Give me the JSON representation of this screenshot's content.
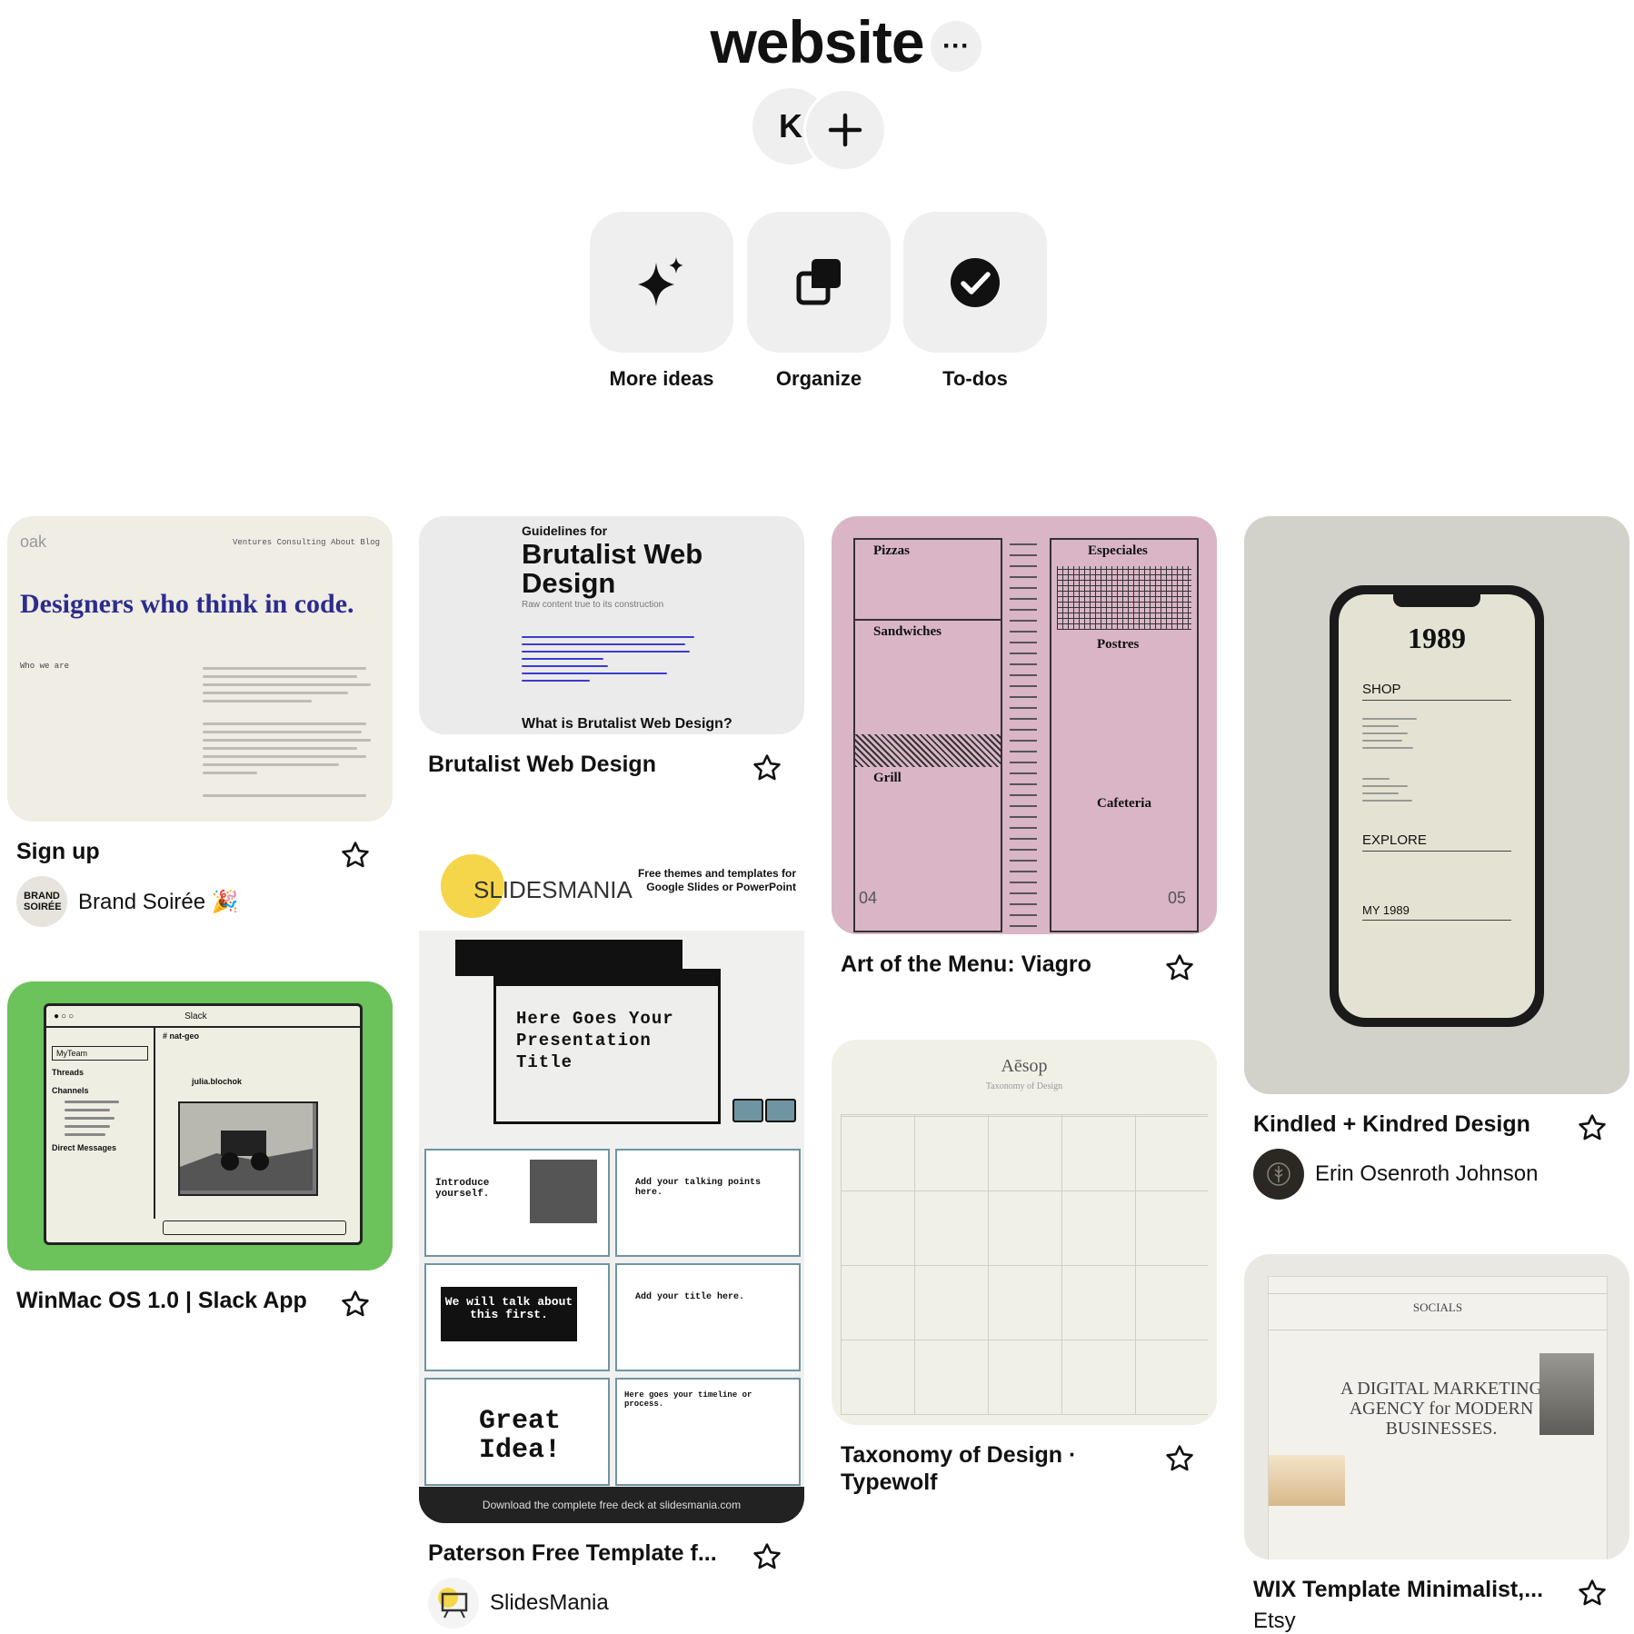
{
  "board": {
    "title": "website",
    "more_label": "···",
    "collaborator_initial": "K"
  },
  "actions": [
    {
      "label": "More ideas",
      "icon": "sparkle-icon"
    },
    {
      "label": "Organize",
      "icon": "organize-icon"
    },
    {
      "label": "To-dos",
      "icon": "check-circle-icon"
    }
  ],
  "pins": {
    "oak": {
      "title": "Sign up",
      "owner": "Brand Soirée 🎉",
      "owner_logo": "BRAND SOIRÉE",
      "img": {
        "logo": "oak",
        "nav": "Ventures   Consulting   About   Blog",
        "headline": "Designers who think in code.",
        "who": "Who we are"
      }
    },
    "slack": {
      "title": "WinMac OS 1.0 | Slack App",
      "img": {
        "app": "Slack",
        "channel": "# nat-geo",
        "team": "MyTeam",
        "threads": "Threads",
        "channels": "Channels",
        "dm": "Direct Messages",
        "user": "julia.blochok"
      }
    },
    "brutalist": {
      "title": "Brutalist Web Design",
      "img": {
        "pre": "Guidelines for",
        "headline": "Brutalist Web Design",
        "sub": "Raw content true to its construction",
        "q": "What is Brutalist Web Design?"
      }
    },
    "slides": {
      "title": "Paterson Free Template f...",
      "owner": "SlidesMania",
      "img": {
        "brand": "SLIDESMANIA",
        "tagline": "Free themes and templates for Google Slides or PowerPoint",
        "main": "Here Goes Your Presentation Title",
        "s1": "Introduce yourself.",
        "s2": "Add your talking points here.",
        "s3": "We will talk about this first.",
        "s4": "Add your title here.",
        "s5": "Great Idea!",
        "s6": "Here goes your timeline or process.",
        "footer": "Download the complete free deck at slidesmania.com"
      }
    },
    "menu": {
      "title": "Art of the Menu: Viagro",
      "img": {
        "c1": "Pizzas",
        "c2": "Sandwiches",
        "c3": "Grill",
        "c4": "Especiales",
        "c5": "Postres",
        "c6": "Cafeteria",
        "p1": "04",
        "p2": "05"
      }
    },
    "aesop": {
      "title": "Taxonomy of Design · Typewolf",
      "img": {
        "brand": "Aēsop",
        "sub": "Taxonomy of Design"
      }
    },
    "phone": {
      "title": "Kindled + Kindred Design",
      "owner": "Erin Osenroth Johnson",
      "img": {
        "brand": "1989",
        "shop": "SHOP",
        "explore": "EXPLORE",
        "my": "MY 1989"
      }
    },
    "wix": {
      "title": "WIX Template Minimalist,...",
      "owner": "Etsy",
      "img": {
        "socials": "SOCIALS",
        "headline": "A DIGITAL MARKETING AGENCY for MODERN BUSINESSES."
      }
    }
  },
  "colors": {
    "pill": "#efefef",
    "pink": "#d9b5c6",
    "green": "#6cc25b",
    "cream": "#efede4"
  }
}
